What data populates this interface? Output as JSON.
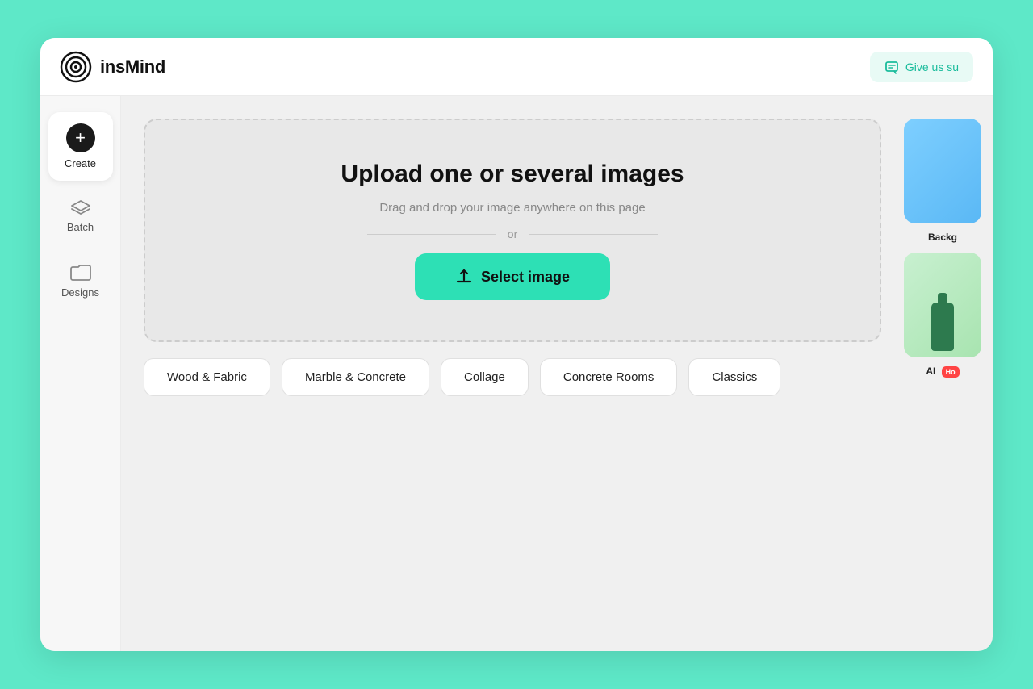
{
  "header": {
    "logo_text": "insMind",
    "feedback_label": "Give us su"
  },
  "sidebar": {
    "items": [
      {
        "id": "create",
        "label": "Create",
        "active": true
      },
      {
        "id": "batch",
        "label": "Batch",
        "active": false
      },
      {
        "id": "designs",
        "label": "Designs",
        "active": false
      }
    ]
  },
  "upload": {
    "title": "Upload one or several images",
    "subtitle": "Drag and drop your image anywhere on this page",
    "divider": "or",
    "button_label": "Select image"
  },
  "categories": [
    {
      "id": "wood-fabric",
      "label": "Wood & Fabric"
    },
    {
      "id": "marble-concrete",
      "label": "Marble & Concrete"
    },
    {
      "id": "collage",
      "label": "Collage"
    },
    {
      "id": "concrete-rooms",
      "label": "Concrete Rooms"
    },
    {
      "id": "classics",
      "label": "Classics"
    }
  ],
  "right_panel": {
    "cards": [
      {
        "id": "backgrounds",
        "label": "Backg",
        "type": "blue"
      },
      {
        "id": "ai",
        "label": "AI",
        "type": "green",
        "badge": "Ho"
      }
    ]
  },
  "colors": {
    "accent": "#2de0b5",
    "bg": "#5ee8c8",
    "select_btn": "#2de0b5"
  }
}
